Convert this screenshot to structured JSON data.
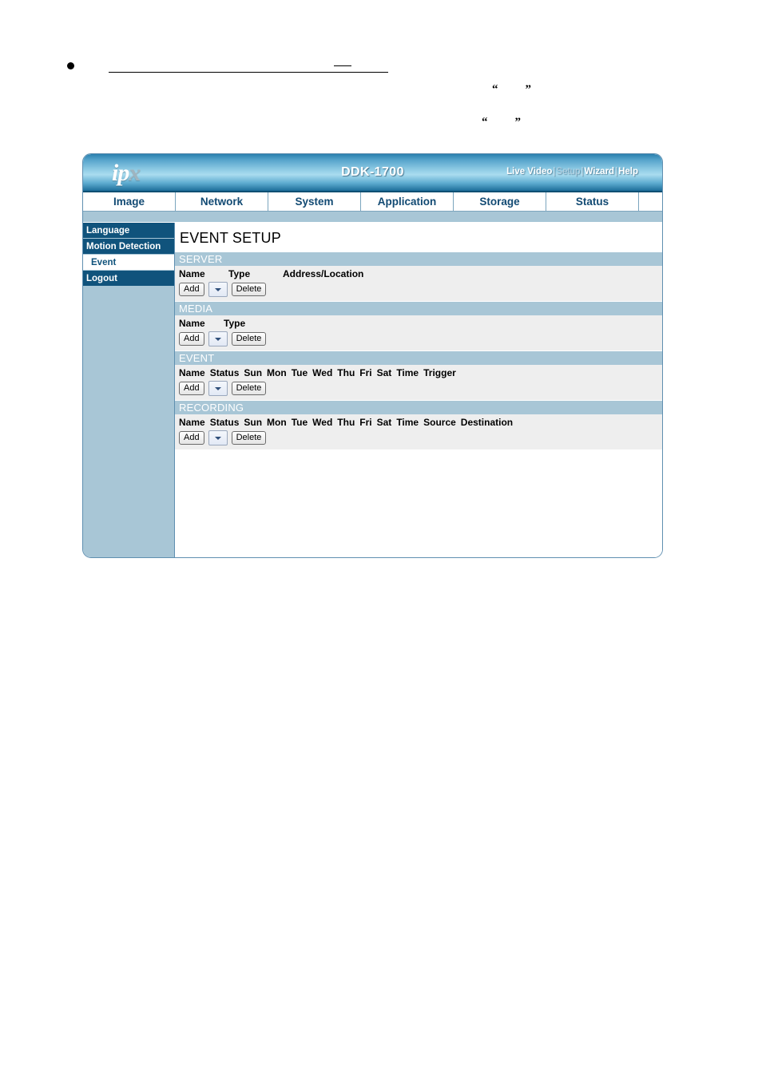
{
  "document": {
    "bullet": "●",
    "quote_pairs": [
      {
        "open": "“",
        "close": "”"
      },
      {
        "open": "“",
        "close": "”"
      }
    ]
  },
  "device_ui": {
    "logo": {
      "primary": "ip",
      "secondary": "x"
    },
    "model": "DDK-1700",
    "header_links": [
      {
        "label": "Live Video",
        "current": false
      },
      {
        "label": "Setup",
        "current": true
      },
      {
        "label": "Wizard",
        "current": false
      },
      {
        "label": "Help",
        "current": false
      }
    ],
    "header_link_separator": "|",
    "tabs": [
      {
        "label": "Image",
        "active": false
      },
      {
        "label": "Network",
        "active": false
      },
      {
        "label": "System",
        "active": false
      },
      {
        "label": "Application",
        "active": false
      },
      {
        "label": "Storage",
        "active": false
      },
      {
        "label": "Status",
        "active": false
      }
    ],
    "sidebar": {
      "items": [
        {
          "label": "Language",
          "active": false
        },
        {
          "label": "Motion Detection",
          "active": false
        },
        {
          "label": "Event",
          "active": true
        },
        {
          "label": "Logout",
          "active": false
        }
      ]
    },
    "page_title": "EVENT SETUP",
    "buttons": {
      "add_label": "Add",
      "delete_label": "Delete",
      "dropdown_selected": ""
    },
    "sections": [
      {
        "id": "server",
        "title": "SERVER",
        "columns": [
          "Name",
          "Type",
          "Address/Location"
        ],
        "rows": []
      },
      {
        "id": "media",
        "title": "MEDIA",
        "columns": [
          "Name",
          "Type"
        ],
        "rows": []
      },
      {
        "id": "event",
        "title": "EVENT",
        "columns": [
          "Name",
          "Status",
          "Sun",
          "Mon",
          "Tue",
          "Wed",
          "Thu",
          "Fri",
          "Sat",
          "Time",
          "Trigger"
        ],
        "rows": []
      },
      {
        "id": "recording",
        "title": "RECORDING",
        "columns": [
          "Name",
          "Status",
          "Sun",
          "Mon",
          "Tue",
          "Wed",
          "Thu",
          "Fri",
          "Sat",
          "Time",
          "Source",
          "Destination"
        ],
        "rows": []
      }
    ],
    "colors": {
      "header_accent": "#1d6d99",
      "sidebar_item": "#10537c",
      "section_bar": "#a8c6d6",
      "row_background": "#eeeeee",
      "tab_text": "#124a73"
    }
  }
}
